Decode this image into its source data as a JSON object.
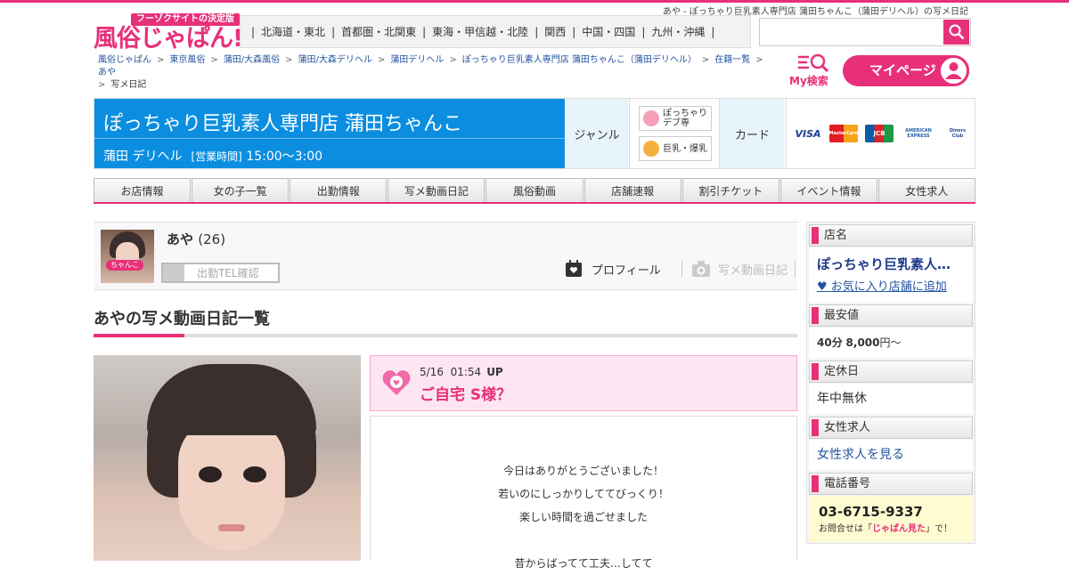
{
  "page_title": "あや - ぽっちゃり巨乳素人専門店 蒲田ちゃんこ（蒲田デリヘル）の写メ日記",
  "logo": {
    "tag": "フーゾクサイトの決定版",
    "main": "風俗じゃぱん!"
  },
  "regions": [
    "北海道・東北",
    "首都圏・北関東",
    "東海・甲信越・北陸",
    "関西",
    "中国・四国",
    "九州・沖縄"
  ],
  "search": {
    "placeholder": ""
  },
  "breadcrumb": [
    "風俗じゃぱん",
    "東京風俗",
    "蒲田/大森風俗",
    "蒲田/大森デリヘル",
    "蒲田デリヘル",
    "ぽっちゃり巨乳素人専門店 蒲田ちゃんこ（蒲田デリヘル）",
    "在籍一覧",
    "あや",
    "写メ日記"
  ],
  "my_search": "My検索",
  "my_page": "マイページ",
  "shop": {
    "name": "ぽっちゃり巨乳素人専門店 蒲田ちゃんこ",
    "area": "蒲田 デリヘル",
    "hours_label": "[営業時間]",
    "hours": "15:00～3:00"
  },
  "genre": {
    "label": "ジャンル",
    "badges": [
      "ぽっちゃりデブ専",
      "巨乳・爆乳"
    ]
  },
  "card": {
    "label": "カード",
    "brands": [
      "VISA",
      "MasterCard",
      "JCB",
      "AMERICAN EXPRESS",
      "Diners Club"
    ]
  },
  "nav": [
    "お店情報",
    "女の子一覧",
    "出勤情報",
    "写メ動画日記",
    "風俗動画",
    "店舗速報",
    "割引チケット",
    "イベント情報",
    "女性求人"
  ],
  "girl": {
    "name": "あや",
    "age": "(26)",
    "photo_badge": "ちゃんこ",
    "tel_button": "出勤TEL確認",
    "tab_profile": "プロフィール",
    "tab_diary": "写メ動画日記"
  },
  "list_heading": "あやの写メ動画日記一覧",
  "entry": {
    "date": "5/16",
    "time": "01:54",
    "up": "UP",
    "title": "ご自宅 S様？",
    "lines": [
      "今日はありがとうございました！",
      "若いのにしっかりしててびっくり！",
      "楽しい時間を過ごせました",
      "",
      "昔からばってて工夫…してて"
    ]
  },
  "sidebar": {
    "shop_label": "店名",
    "shop_name": "ぽっちゃり巨乳素人…",
    "favorite": "♥ お気に入り店舗に追加",
    "price_label": "最安値",
    "price_min": "40分",
    "price": "8,000",
    "price_unit": "円～",
    "holiday_label": "定休日",
    "holiday": "年中無休",
    "recruit_label": "女性求人",
    "recruit_link": "女性求人を見る",
    "tel_label": "電話番号",
    "tel": "03-6715-9337",
    "tel_note_pre": "お問合せは「",
    "tel_note_em": "じゃぱん見た",
    "tel_note_post": "」で！"
  },
  "colors": {
    "accent": "#e8307a",
    "shop_blue": "#0b8ee0",
    "link": "#2456a0"
  }
}
